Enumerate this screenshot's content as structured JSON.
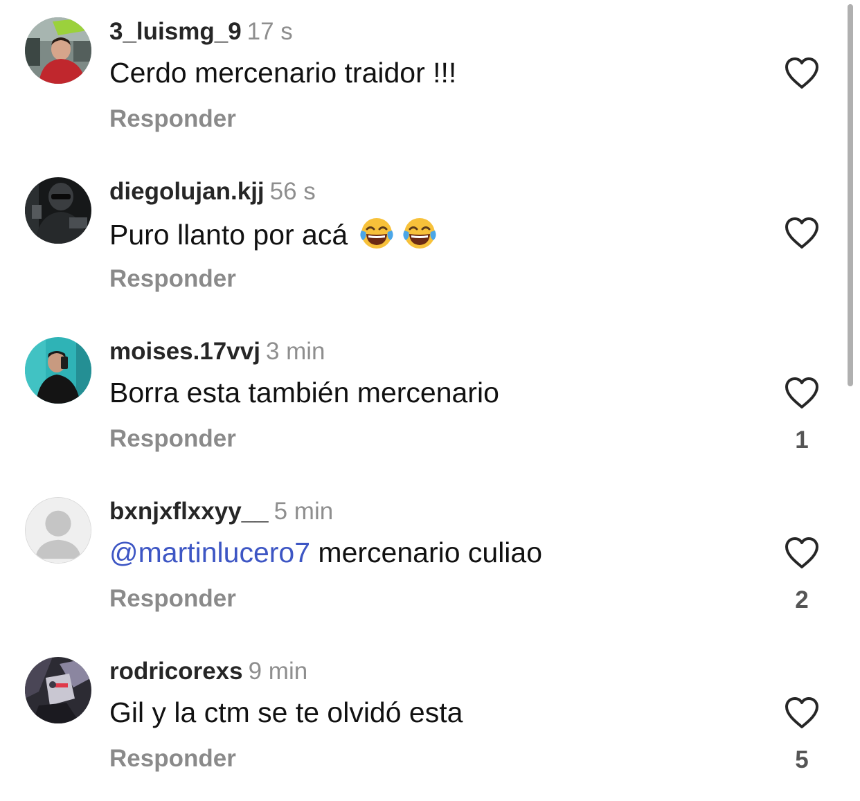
{
  "comments": [
    {
      "username": "3_luismg_9",
      "time": "17 s",
      "text": "Cerdo mercenario traidor !!!",
      "reply_label": "Responder",
      "like_count": ""
    },
    {
      "username": "diegolujan.kjj",
      "time": "56 s",
      "text": "Puro llanto por acá",
      "emojis": [
        "face-with-tears-of-joy",
        "face-with-tears-of-joy"
      ],
      "reply_label": "Responder",
      "like_count": ""
    },
    {
      "username": "moises.17vvj",
      "time": "3 min",
      "text": "Borra esta también mercenario",
      "reply_label": "Responder",
      "like_count": "1"
    },
    {
      "username": "bxnjxflxxyy__",
      "time": "5 min",
      "mention": "@martinlucero7",
      "text": "mercenario culiao",
      "reply_label": "Responder",
      "like_count": "2"
    },
    {
      "username": "rodricorexs",
      "time": "9 min",
      "text": "Gil y la ctm se te olvidó esta",
      "reply_label": "Responder",
      "like_count": "5"
    }
  ],
  "icons": {
    "like": "heart-outline-icon",
    "default_avatar": "person-silhouette-icon"
  },
  "colors": {
    "mention": "#3d56c4",
    "secondary_text": "#8e8e8e",
    "primary_text": "#111111"
  }
}
